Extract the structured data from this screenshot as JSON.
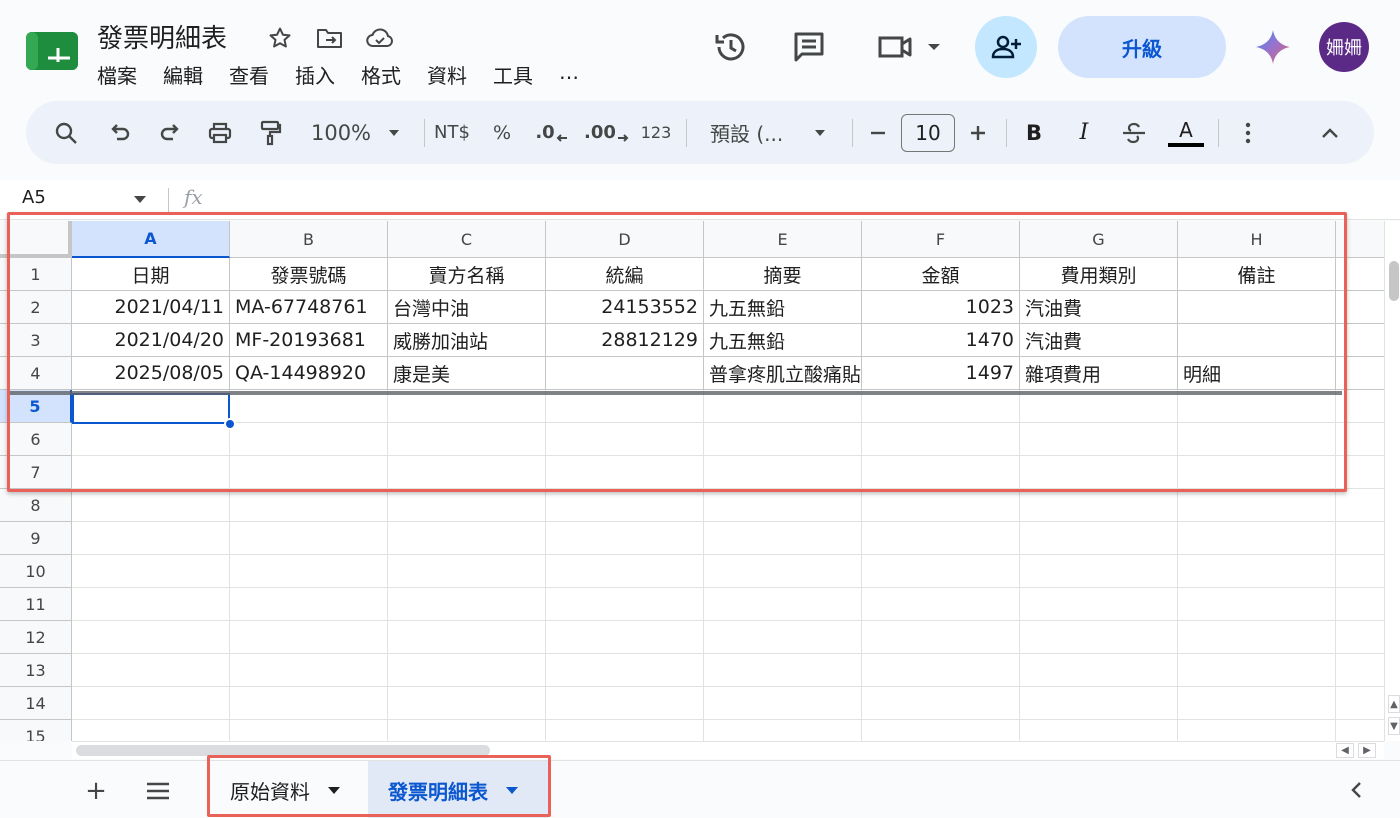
{
  "app": {
    "title": "發票明細表",
    "menu": [
      "檔案",
      "編輯",
      "查看",
      "插入",
      "格式",
      "資料",
      "工具",
      "…"
    ],
    "upgrade_label": "升級",
    "avatar_text": "姍姍",
    "accent_color": "#0b57d0"
  },
  "toolbar": {
    "zoom": "100%",
    "currency": "NT$",
    "percent": "%",
    "dec_decrease": ".0",
    "dec_increase": ".00",
    "number_format": "123",
    "font_name": "預設 (...",
    "font_size": "10",
    "bold": "B",
    "italic": "I",
    "text_color": "A"
  },
  "formula_bar": {
    "name_box": "A5",
    "fx": "fx"
  },
  "grid": {
    "columns": [
      "A",
      "B",
      "C",
      "D",
      "E",
      "F",
      "G",
      "H"
    ],
    "row_numbers": [
      "1",
      "2",
      "3",
      "4",
      "5",
      "6",
      "7",
      "8",
      "9",
      "10",
      "11",
      "12",
      "13",
      "14",
      "15"
    ],
    "selected_cell": "A5",
    "rows": [
      [
        "日期",
        "發票號碼",
        "賣方名稱",
        "統編",
        "摘要",
        "金額",
        "費用類別",
        "備註"
      ],
      [
        "2021/04/11",
        "MA-67748761",
        "台灣中油",
        "24153552",
        "九五無鉛",
        "1023",
        "汽油費",
        ""
      ],
      [
        "2021/04/20",
        "MF-20193681",
        "威勝加油站",
        "28812129",
        "九五無鉛",
        "1470",
        "汽油費",
        ""
      ],
      [
        "2025/08/05",
        "QA-14498920",
        "康是美",
        "",
        "普拿疼肌立酸痛貼",
        "1497",
        "雜項費用",
        "明細"
      ]
    ]
  },
  "sheets": {
    "tabs": [
      {
        "label": "原始資料",
        "active": false
      },
      {
        "label": "發票明細表",
        "active": true
      }
    ],
    "add_label": "+",
    "annotation_color": "#e8625a"
  }
}
